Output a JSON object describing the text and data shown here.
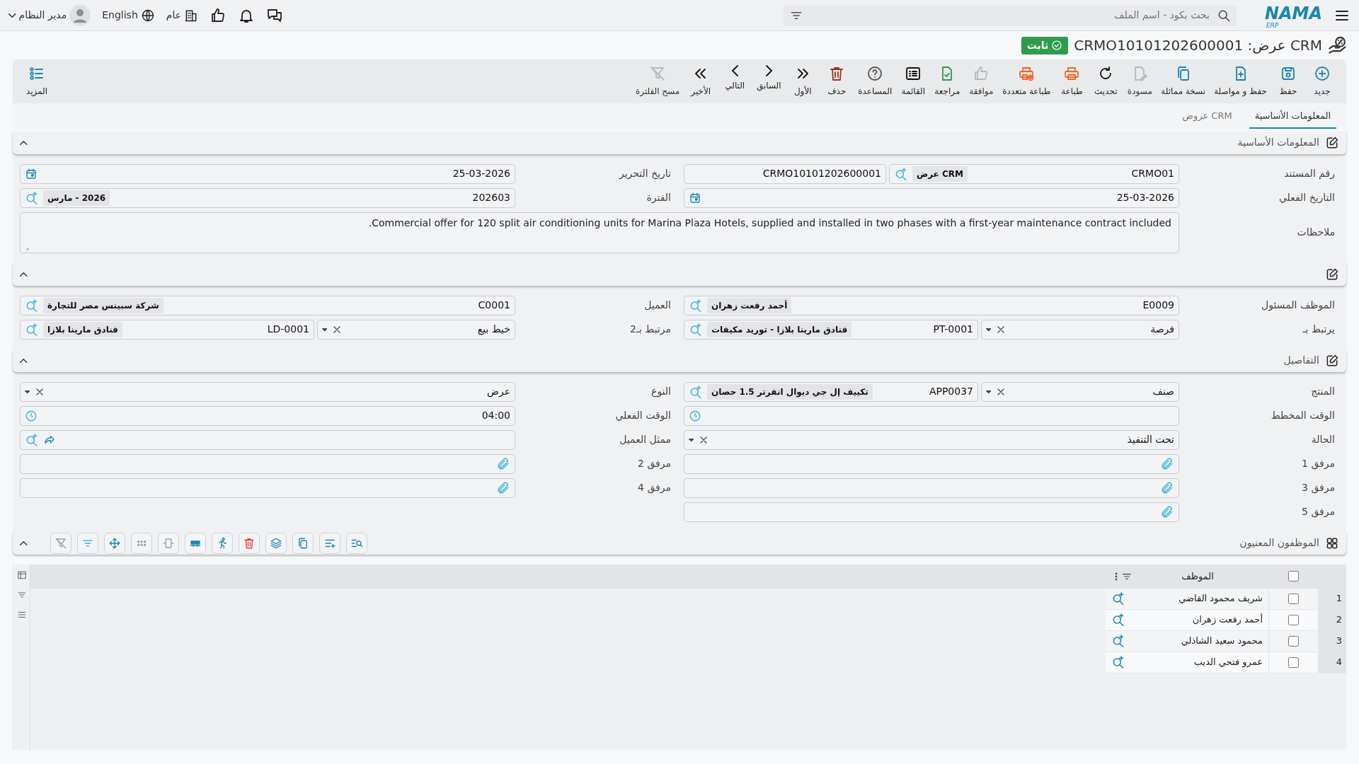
{
  "topbar": {
    "logo": "NAMA",
    "logo_sub": "ERP",
    "search": {
      "placeholder": "بحث بكود - اسم الملف"
    },
    "company": "عام",
    "language": "English",
    "user": "مدير النظام"
  },
  "document": {
    "title": "CRM عرض: CRMO10101202600001",
    "status": "ثابت"
  },
  "toolbar": [
    {
      "label": "جديد",
      "disabled": false
    },
    {
      "label": "حفظ",
      "disabled": false
    },
    {
      "label": "حفظ و مواصلة",
      "disabled": false
    },
    {
      "label": "نسخة مماثلة",
      "disabled": false
    },
    {
      "label": "مسودة",
      "disabled": true
    },
    {
      "label": "تحديث",
      "disabled": false
    },
    {
      "label": "طباعة",
      "disabled": false
    },
    {
      "label": "طباعة متعددة",
      "disabled": false
    },
    {
      "label": "موافقة",
      "disabled": true
    },
    {
      "label": "مراجعة",
      "disabled": false
    },
    {
      "label": "القائمة",
      "disabled": false
    },
    {
      "label": "المساعدة",
      "disabled": false
    },
    {
      "label": "حذف",
      "disabled": false
    },
    {
      "label": "الأول",
      "disabled": false
    },
    {
      "label": "السابق",
      "disabled": false
    },
    {
      "label": "التالي",
      "disabled": false
    },
    {
      "label": "الأخير",
      "disabled": false
    },
    {
      "label": "مسح الفلترة",
      "disabled": true
    }
  ],
  "more": "المزيد",
  "tabs": [
    {
      "label": "المعلومات الأساسية",
      "selected": true
    },
    {
      "label": "CRM عروض",
      "selected": false
    }
  ],
  "sections": [
    {
      "title": "المعلومات الأساسية",
      "expanded": true,
      "rows": [
        [
          {
            "label": "رقم المستند",
            "kind": "docnumber",
            "code": "CRMO01",
            "name": "CRM عرض",
            "value": "CRMO10101202600001"
          },
          {
            "label": "تاريخ التحرير",
            "kind": "date",
            "value": "25-03-2026"
          }
        ],
        [
          {
            "label": "التاريخ الفعلي",
            "kind": "date",
            "value": "25-03-2026"
          },
          {
            "label": "الفترة",
            "kind": "lookup",
            "code": "202603",
            "name": "2026 - مارس"
          }
        ],
        [
          {
            "label": "ملاحظات",
            "kind": "notes",
            "value": "Commercial offer for 120 split air conditioning units for Marina Plaza Hotels, supplied and installed in two phases with a first-year maintenance contract included."
          }
        ]
      ]
    },
    {
      "expanded": true,
      "rows": [
        [
          {
            "label": "الموظف المسئول",
            "kind": "lookup",
            "code": "E0009",
            "name": "أحمد رفعت زهران"
          },
          {
            "label": "العميل",
            "kind": "lookup",
            "code": "C0001",
            "name": "شركة سبينس مصر للتجارة"
          }
        ],
        [
          {
            "label": "يرتبط بـ",
            "kind": "linked",
            "type": "فرصة",
            "code": "PT-0001",
            "name": "فنادق مارينا بلازا - توريد مكيفات"
          },
          {
            "label": "مرتبط بـ2",
            "kind": "linked",
            "type": "خيط بيع",
            "code": "LD-0001",
            "name": "فنادق مارينا بلازا"
          }
        ]
      ]
    },
    {
      "title": "التفاصيل",
      "expanded": true,
      "rows": [
        [
          {
            "label": "المنتج",
            "kind": "linked",
            "type": "صنف",
            "code": "APP0037",
            "name": "تكييف إل جي ديوال انفرتر 1.5 حصان"
          },
          {
            "label": "النوع",
            "kind": "select",
            "value": "عرض"
          }
        ],
        [
          {
            "label": "الوقت المخطط",
            "kind": "time"
          },
          {
            "label": "الوقت الفعلي",
            "kind": "time",
            "value": "04:00"
          }
        ],
        [
          {
            "label": "الحالة",
            "kind": "select",
            "value": "تحت التنفيذ"
          },
          {
            "label": "ممثل العميل",
            "kind": "contact"
          }
        ],
        [
          {
            "label": "مرفق 1",
            "kind": "attachment"
          },
          {
            "label": "مرفق 2",
            "kind": "attachment"
          }
        ],
        [
          {
            "label": "مرفق 3",
            "kind": "attachment"
          },
          {
            "label": "مرفق 4",
            "kind": "attachment"
          }
        ],
        [
          {
            "label": "مرفق 5",
            "kind": "attachment"
          }
        ]
      ]
    }
  ],
  "employees": {
    "title": "الموظفون المعنيون",
    "expanded": true,
    "column": "الموظف",
    "all_checked": false,
    "rows": [
      {
        "number": "1",
        "name": "شريف محمود القاضي",
        "checked": false
      },
      {
        "number": "2",
        "name": "أحمد رفعت زهران",
        "checked": false
      },
      {
        "number": "3",
        "name": "محمود سعيد الشاذلي",
        "checked": false
      },
      {
        "number": "4",
        "name": "عمرو فتحي الديب",
        "checked": false
      }
    ]
  }
}
